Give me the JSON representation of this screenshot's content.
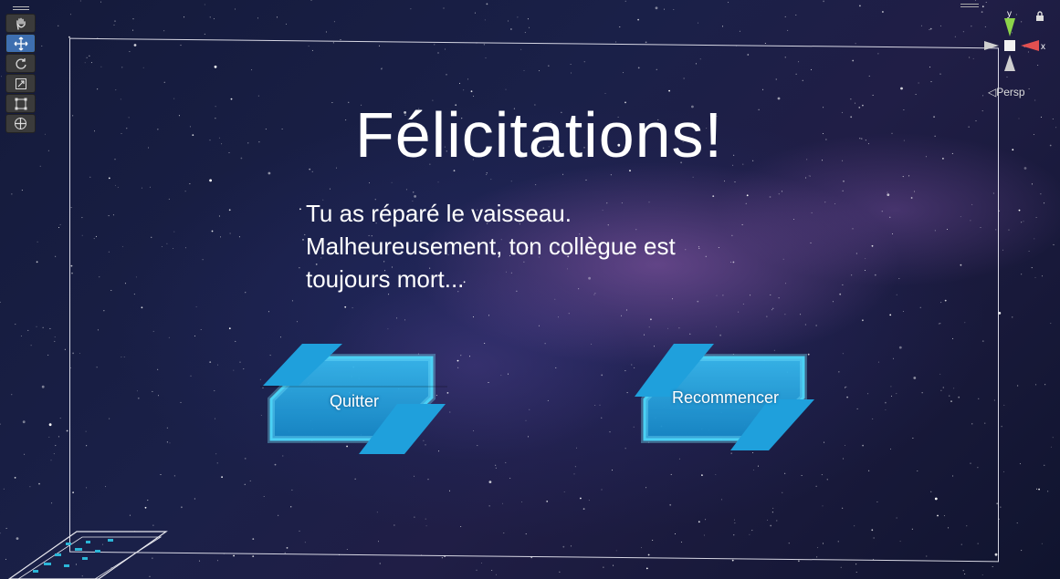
{
  "screen": {
    "title": "Félicitations!",
    "message_lines": [
      "Tu as réparé le vaisseau.",
      "Malheureusement, ton collègue est",
      "toujours mort..."
    ]
  },
  "buttons": {
    "quit": {
      "label": "Quitter"
    },
    "restart": {
      "label": "Recommencer"
    }
  },
  "editor": {
    "tools": [
      {
        "name": "hand-tool",
        "icon": "hand-icon",
        "active": false
      },
      {
        "name": "move-tool",
        "icon": "move-icon",
        "active": true
      },
      {
        "name": "rotate-tool",
        "icon": "rotate-icon",
        "active": false
      },
      {
        "name": "scale-tool",
        "icon": "scale-icon",
        "active": false
      },
      {
        "name": "rect-tool",
        "icon": "rect-transform-icon",
        "active": false
      },
      {
        "name": "transform-tool",
        "icon": "transform-icon",
        "active": false
      }
    ],
    "gizmo": {
      "y_label": "y",
      "x_label": "x",
      "projection_label": "Persp"
    }
  },
  "colors": {
    "button_fill": "#1aa3e0",
    "button_edge": "#28c8f5",
    "active_tool": "#3e6fb0",
    "gizmo_y": "#8cd44a",
    "gizmo_x": "#e25050"
  }
}
